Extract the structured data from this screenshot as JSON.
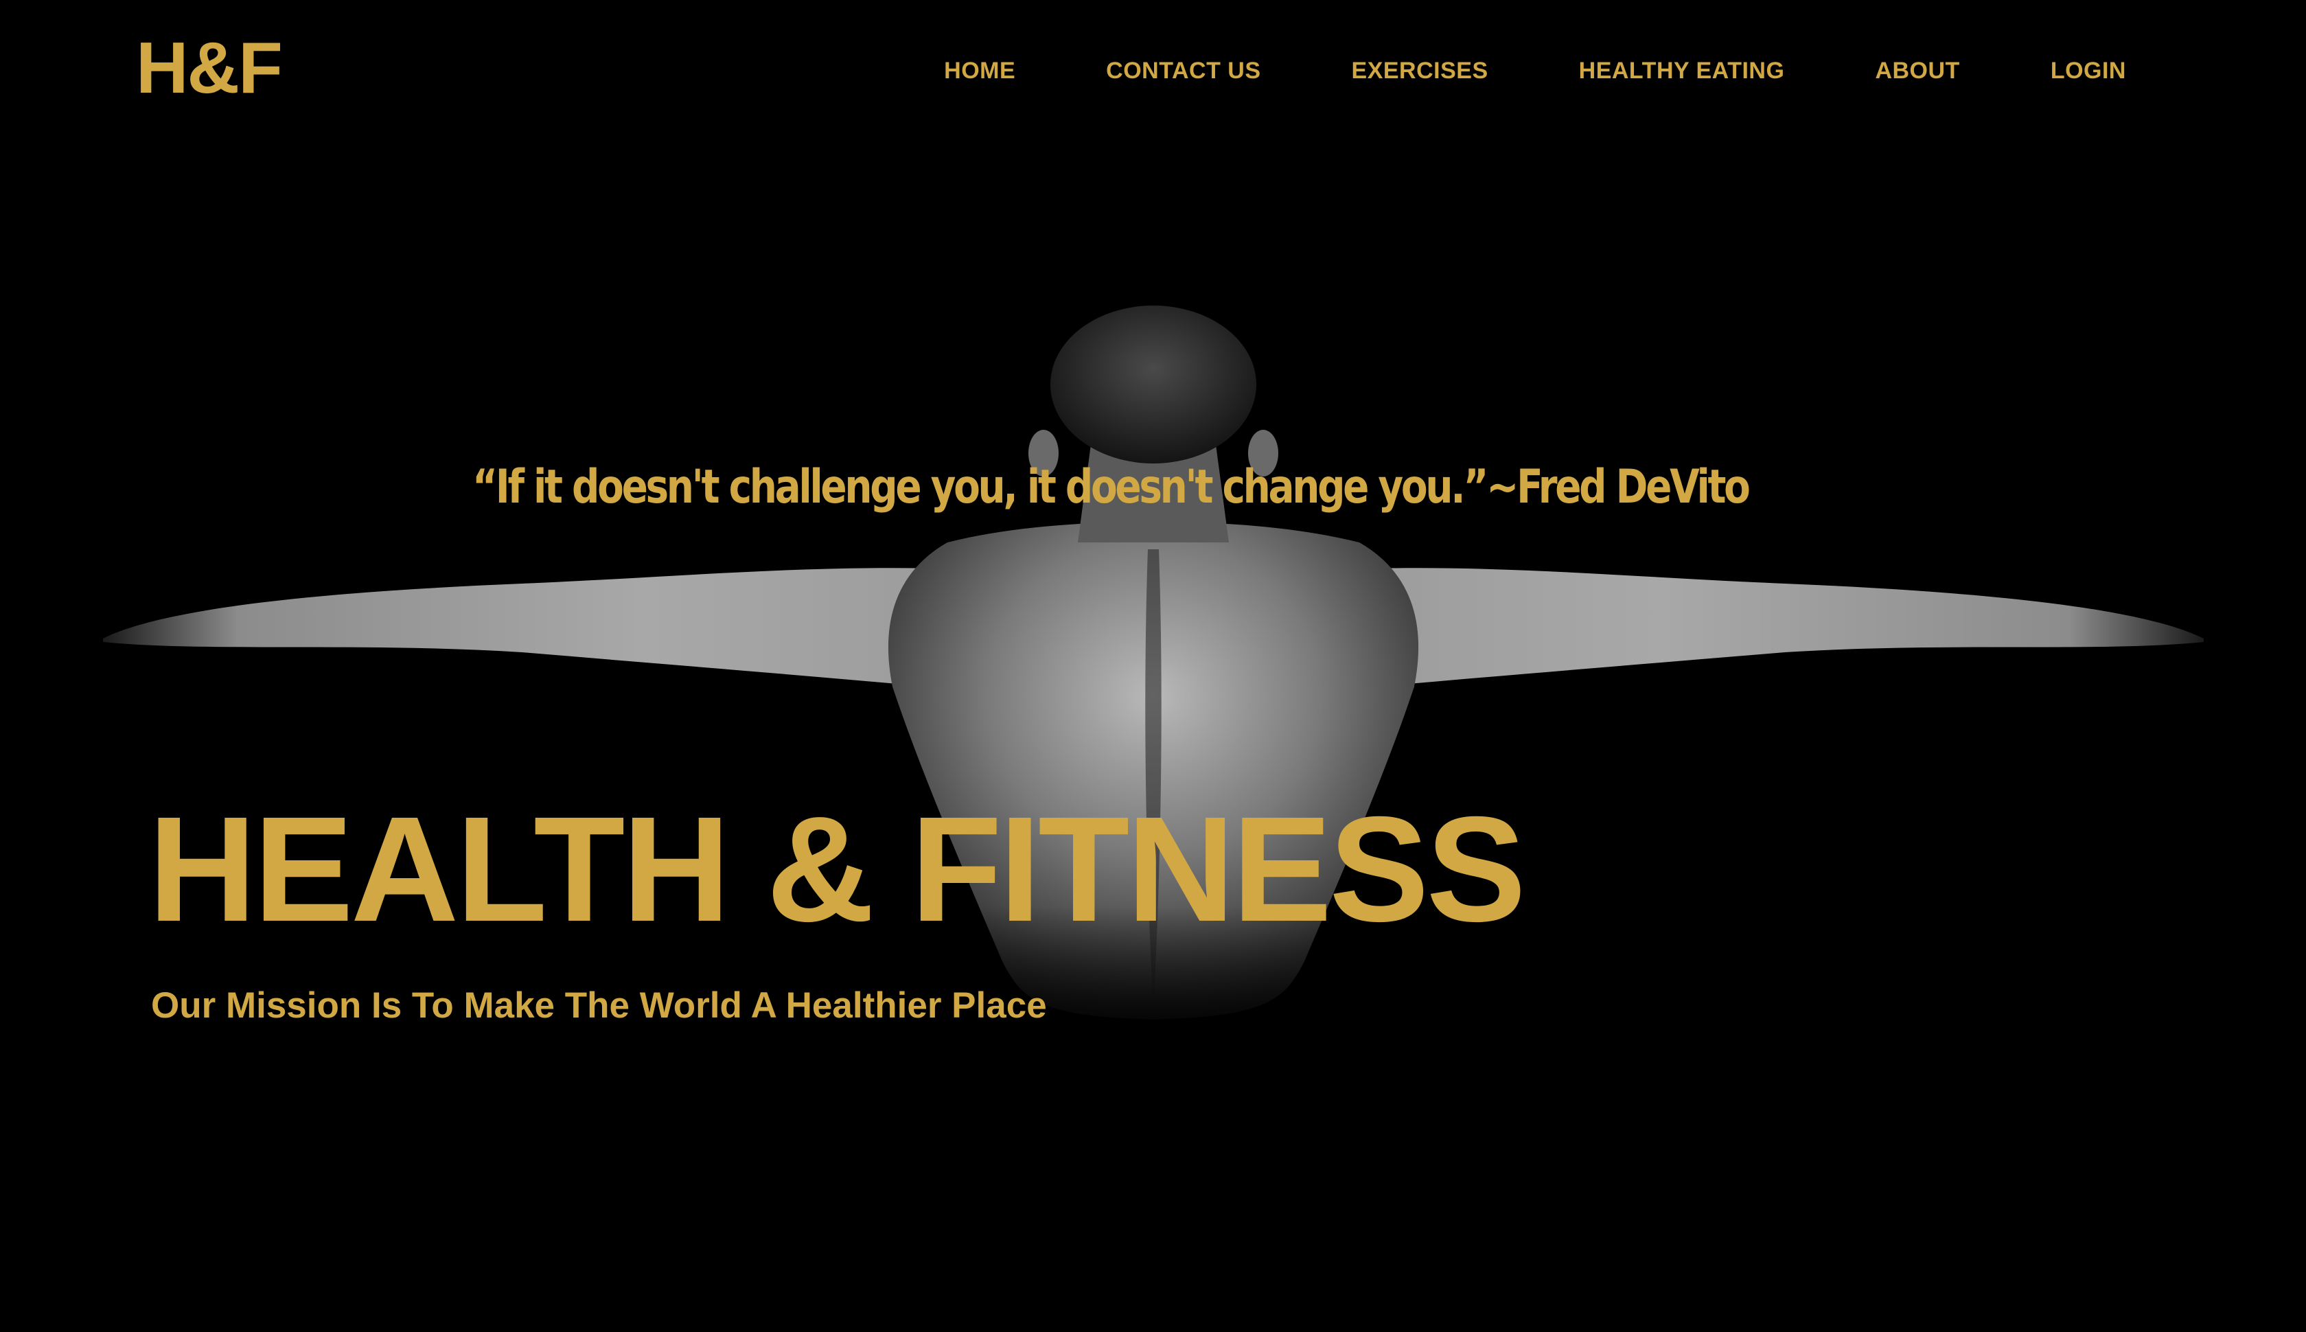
{
  "colors": {
    "background": "#000000",
    "accent_gold": "#D1A843"
  },
  "header": {
    "logo": "H&F",
    "nav": [
      {
        "label": "HOME"
      },
      {
        "label": "CONTACT US"
      },
      {
        "label": "EXERCISES"
      },
      {
        "label": "HEALTHY EATING"
      },
      {
        "label": "ABOUT"
      },
      {
        "label": "LOGIN"
      }
    ]
  },
  "hero": {
    "image_subject": "athlete-back-arms-outstretched",
    "quote": "“If it doesn't challenge you,  it doesn't change you.”~Fred DeVito",
    "title": "HEALTH & FITNESS",
    "tagline": "Our Mission Is To Make The World A Healthier Place"
  }
}
